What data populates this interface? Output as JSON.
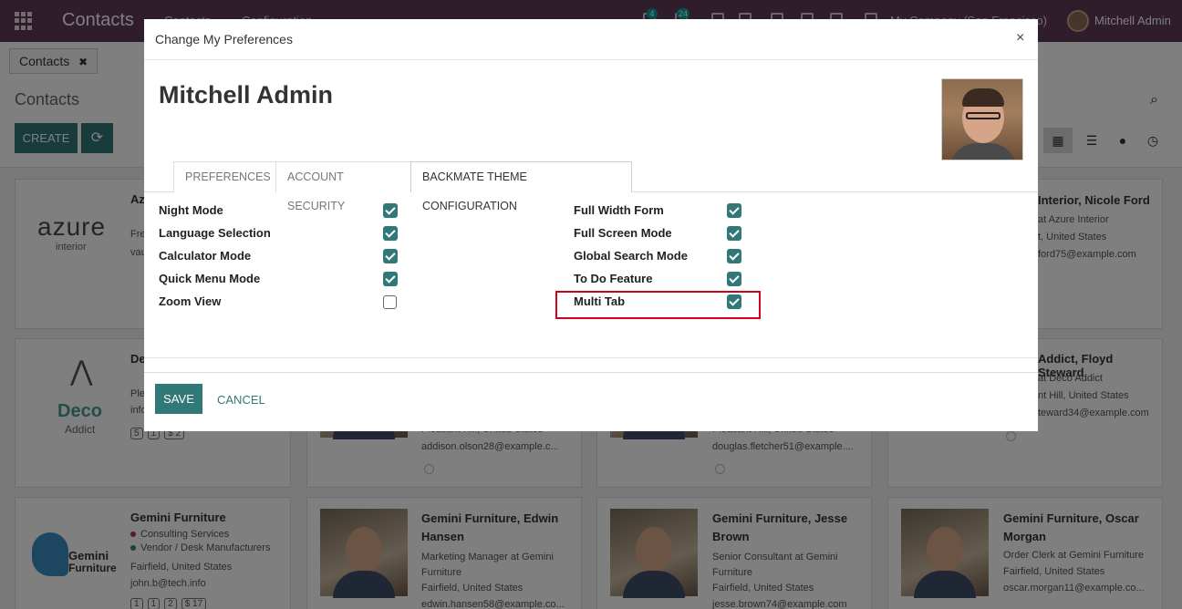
{
  "navbar": {
    "app_title": "Contacts",
    "menu": [
      "Contacts",
      "Configuration"
    ],
    "badges": [
      "4",
      "24"
    ],
    "company": "My Company (San Francisco)",
    "user": "Mitchell Admin"
  },
  "control": {
    "breadcrumb": "Contacts",
    "breadcrumb_close": "✖",
    "page_title": "Contacts",
    "create_label": "CREATE",
    "refresh_icon": "⟳",
    "search_icon": "⌕",
    "view_icons": [
      "kanban-icon",
      "list-icon",
      "map-pin-icon",
      "clock-icon"
    ]
  },
  "kanban": {
    "azure": {
      "logo_main": "azure",
      "logo_sub": "interior",
      "name": "Az",
      "lines": [
        "Fre",
        "vau"
      ]
    },
    "azure_nicole": {
      "name": "Interior, Nicole Ford",
      "lines": [
        "at Azure Interior",
        "t, United States",
        "ford75@example.com"
      ]
    },
    "deco": {
      "logo_main": "Deco",
      "logo_sub": "Addict",
      "name": "De",
      "lines": [
        "Ple",
        "info"
      ],
      "badges": [
        "5",
        "1",
        "$ 2"
      ]
    },
    "deco_floyd": {
      "name": "Addict, Floyd Steward",
      "lines": [
        "at Deco Addict",
        "nt Hill, United States",
        "teward34@example.com"
      ]
    },
    "partial_addison": {
      "lines": [
        "Pleasant Hill, United States",
        "addison.olson28@example.c..."
      ]
    },
    "partial_douglas": {
      "lines": [
        "Pleasant Hill, United States",
        "douglas.fletcher51@example...."
      ]
    },
    "gemini": {
      "logo_main": "Gemini",
      "logo_sub": "Furniture",
      "name": "Gemini Furniture",
      "tags": [
        "Consulting Services",
        "Vendor / Desk Manufacturers"
      ],
      "lines": [
        "Fairfield, United States",
        "john.b@tech.info"
      ],
      "badges": [
        "1",
        "1",
        "2",
        "$ 17"
      ]
    },
    "edwin": {
      "name": "Gemini Furniture, Edwin Hansen",
      "lines": [
        "Marketing Manager at Gemini Furniture",
        "Fairfield, United States",
        "edwin.hansen58@example.co..."
      ]
    },
    "jesse": {
      "name": "Gemini Furniture, Jesse Brown",
      "lines": [
        "Senior Consultant at Gemini Furniture",
        "Fairfield, United States",
        "jesse.brown74@example.com"
      ]
    },
    "oscar": {
      "name": "Gemini Furniture, Oscar Morgan",
      "lines": [
        "Order Clerk at Gemini Furniture",
        "Fairfield, United States",
        "oscar.morgan11@example.co..."
      ]
    }
  },
  "modal": {
    "title": "Change My Preferences",
    "close": "×",
    "user_name": "Mitchell Admin",
    "tabs": [
      "PREFERENCES",
      "ACCOUNT SECURITY",
      "BACKMATE THEME CONFIGURATION"
    ],
    "active_tab": "BACKMATE THEME CONFIGURATION",
    "left_fields": [
      {
        "label": "Night Mode",
        "checked": true
      },
      {
        "label": "Language Selection",
        "checked": true
      },
      {
        "label": "Calculator Mode",
        "checked": true
      },
      {
        "label": "Quick Menu Mode",
        "checked": true
      },
      {
        "label": "Zoom View",
        "checked": false
      }
    ],
    "right_fields": [
      {
        "label": "Full Width Form",
        "checked": true
      },
      {
        "label": "Full Screen Mode",
        "checked": true
      },
      {
        "label": "Global Search Mode",
        "checked": true
      },
      {
        "label": "To Do Feature",
        "checked": true
      },
      {
        "label": "Multi Tab",
        "checked": true
      }
    ],
    "save_label": "SAVE",
    "cancel_label": "CANCEL"
  },
  "colors": {
    "brand": "#5e3a58",
    "accent": "#317878",
    "highlight": "#d0021b"
  }
}
